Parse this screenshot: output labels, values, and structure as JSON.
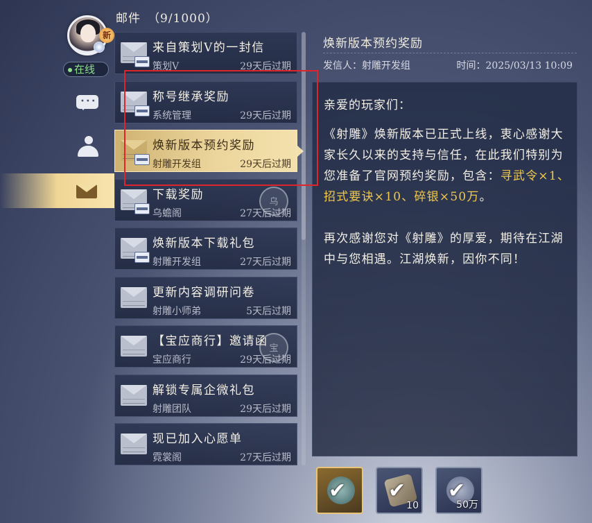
{
  "header": {
    "title": "邮件",
    "count": "（9/1000）"
  },
  "nav": {
    "new_badge": "新",
    "status": "在线",
    "tabs": [
      {
        "name": "chat-icon"
      },
      {
        "name": "person-icon"
      },
      {
        "name": "mail-icon",
        "active": true
      }
    ]
  },
  "mails": [
    {
      "title": "来自策划V的一封信",
      "sender": "策划V",
      "expire": "29天后过期",
      "attachment": true,
      "active": false
    },
    {
      "title": "称号继承奖励",
      "sender": "系统管理",
      "expire": "29天后过期",
      "attachment": true,
      "active": false
    },
    {
      "title": "焕新版本预约奖励",
      "sender": "射雕开发组",
      "expire": "29天后过期",
      "attachment": true,
      "active": true
    },
    {
      "title": "下载奖励",
      "sender": "乌蟾阁",
      "expire": "27天后过期",
      "attachment": true,
      "active": false,
      "stamp": "乌"
    },
    {
      "title": "焕新版本下载礼包",
      "sender": "射雕开发组",
      "expire": "27天后过期",
      "attachment": true,
      "active": false
    },
    {
      "title": "更新内容调研问卷",
      "sender": "射雕小师弟",
      "expire": "5天后过期",
      "attachment": false,
      "active": false
    },
    {
      "title": "【宝应商行】邀请函",
      "sender": "宝应商行",
      "expire": "29天后过期",
      "attachment": false,
      "active": false,
      "stamp": "宝"
    },
    {
      "title": "解锁专属企微礼包",
      "sender": "射雕团队",
      "expire": "29天后过期",
      "attachment": false,
      "active": false
    },
    {
      "title": "现已加入心愿单",
      "sender": "霓裳阁",
      "expire": "27天后过期",
      "attachment": false,
      "active": false
    }
  ],
  "detail": {
    "title": "焕新版本预约奖励",
    "sender": "发信人：射雕开发组",
    "time": "时间：2025/03/13 10:09",
    "greeting": "亲爱的玩家们：",
    "para1_a": "《射雕》焕新版本已正式上线，衷心感谢大家长久以来的支持与信任，在此我们特别为您准备了官网预约奖励，包含：",
    "para1_b": "寻武令×1、招式要诀×10、碎银×50万",
    "para1_c": "。",
    "para2": "再次感谢您对《射雕》的厚爱，期待在江湖中与您相遇。江湖焕新，因你不同！"
  },
  "rewards": [
    {
      "name": "寻武令",
      "qty": "",
      "icon": "token-icon"
    },
    {
      "name": "招式要诀",
      "qty": "10",
      "icon": "scroll-icon"
    },
    {
      "name": "碎银",
      "qty": "50万",
      "icon": "silver-icon"
    }
  ],
  "colors": {
    "highlight_box": "#e0252a",
    "gold_text": "#f2c94c",
    "online_green": "#8ee08a"
  }
}
